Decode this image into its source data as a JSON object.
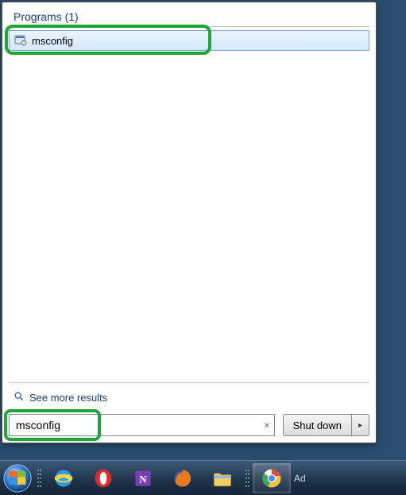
{
  "programs_header": "Programs (1)",
  "result": {
    "label": "msconfig"
  },
  "see_more": "See more results",
  "search": {
    "value": "msconfig",
    "clear_glyph": "×"
  },
  "shutdown": {
    "label": "Shut down",
    "arrow": "▸"
  },
  "tray": {
    "label": "Ad"
  }
}
